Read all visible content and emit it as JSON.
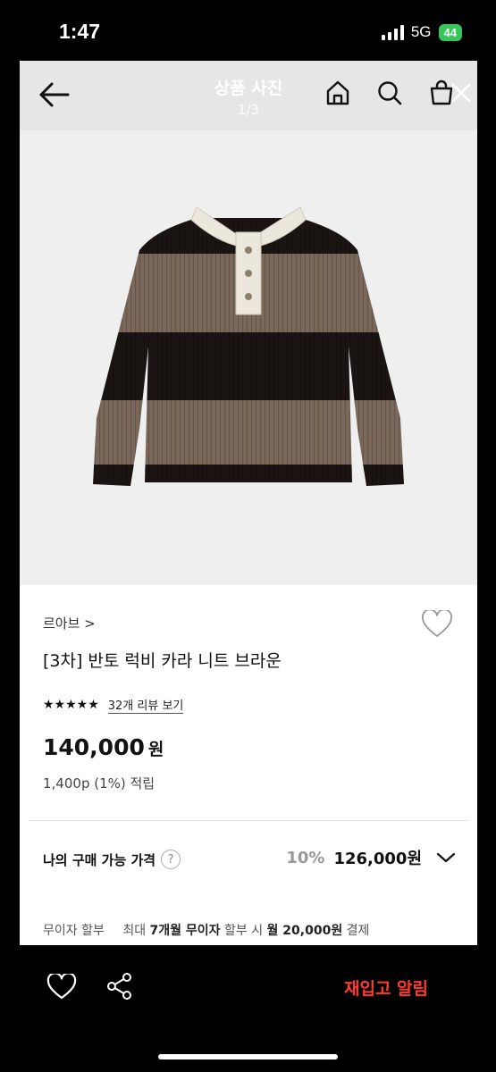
{
  "status": {
    "time": "1:47",
    "network": "5G",
    "battery": "44"
  },
  "nav": {
    "title": "상품 사진",
    "counter": "1/3"
  },
  "product": {
    "brand": "르아브 >",
    "name": "[3차] 반토 럭비 카라 니트 브라운",
    "stars": "★★★★★",
    "review_link": "32개 리뷰 보기",
    "price": "140,000",
    "price_unit": "원",
    "points": "1,400p (1%) 적립"
  },
  "my_price": {
    "label": "나의 구매 가능 가격",
    "help": "?",
    "discount": "10%",
    "value": "126,000원"
  },
  "installment": {
    "label": "무이자 할부",
    "p1": "최대",
    "b1": "7개월 무이자",
    "p2": "할부 시",
    "b2": "월 20,000원",
    "p3": "결제"
  },
  "bottom": {
    "restock": "재입고 알림"
  },
  "colors": {
    "accent": "#ff3b2f",
    "brown_stripe": "#7a685b",
    "black_stripe": "#1a1512",
    "collar": "#ece7dd"
  },
  "icons": [
    "back-arrow-icon",
    "home-icon",
    "search-icon",
    "cart-icon",
    "close-icon",
    "heart-icon",
    "question-icon",
    "chevron-down-icon",
    "share-icon"
  ]
}
